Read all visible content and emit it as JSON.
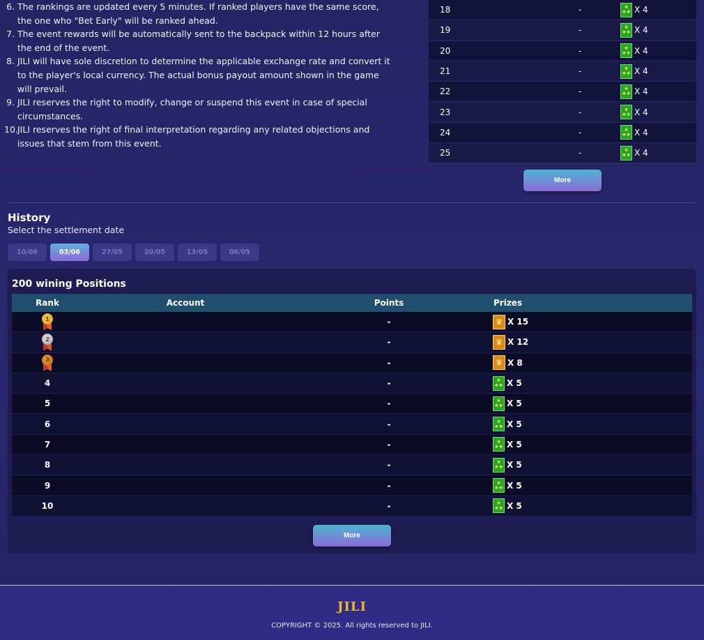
{
  "rules": [
    {
      "num": "6.",
      "text": "The rankings are updated every 5 minutes. If ranked players have the same score, the one who \"Bet Early\" will be ranked ahead."
    },
    {
      "num": "7.",
      "text": "The event rewards will be automatically sent to the backpack within 12 hours after the end of the event."
    },
    {
      "num": "8.",
      "text": "JILI will have sole discretion to determine the applicable exchange rate and convert it to the player's local currency. The actual bonus payout amount shown in the game will prevail."
    },
    {
      "num": "9.",
      "text": "JILI reserves the right to modify, change or suspend this event in case of special circumstances."
    },
    {
      "num": "10.",
      "text": "JILI reserves the right of final interpretation regarding any related objections and issues that stem from this event."
    }
  ],
  "current_ranking": {
    "rows": [
      {
        "rank": "18",
        "points": "-",
        "prize": "X 4"
      },
      {
        "rank": "19",
        "points": "-",
        "prize": "X 4"
      },
      {
        "rank": "20",
        "points": "-",
        "prize": "X 4"
      },
      {
        "rank": "21",
        "points": "-",
        "prize": "X 4"
      },
      {
        "rank": "22",
        "points": "-",
        "prize": "X 4"
      },
      {
        "rank": "23",
        "points": "-",
        "prize": "X 4"
      },
      {
        "rank": "24",
        "points": "-",
        "prize": "X 4"
      },
      {
        "rank": "25",
        "points": "-",
        "prize": "X 4"
      }
    ],
    "more_label": "More"
  },
  "history": {
    "title": "History",
    "subtitle": "Select the settlement date",
    "dates": [
      "10/06",
      "03/06",
      "27/05",
      "20/05",
      "13/05",
      "06/05"
    ],
    "active_date_index": 1,
    "panel_title": "200 wining Positions",
    "columns": {
      "rank": "Rank",
      "account": "Account",
      "points": "Points",
      "prizes": "Prizes"
    },
    "rows": [
      {
        "rank": "1",
        "medal": "gold",
        "account": "",
        "points": "-",
        "prize_icon": "crown-chest-icon",
        "prize": "X 15"
      },
      {
        "rank": "2",
        "medal": "silver",
        "account": "",
        "points": "-",
        "prize_icon": "crown-chest-icon",
        "prize": "X 12"
      },
      {
        "rank": "3",
        "medal": "bronze",
        "account": "",
        "points": "-",
        "prize_icon": "crown-chest-icon",
        "prize": "X 8"
      },
      {
        "rank": "4",
        "medal": "",
        "account": "",
        "points": "-",
        "prize_icon": "star-gift-icon",
        "prize": "X 5"
      },
      {
        "rank": "5",
        "medal": "",
        "account": "",
        "points": "-",
        "prize_icon": "star-gift-icon",
        "prize": "X 5"
      },
      {
        "rank": "6",
        "medal": "",
        "account": "",
        "points": "-",
        "prize_icon": "star-gift-icon",
        "prize": "X 5"
      },
      {
        "rank": "7",
        "medal": "",
        "account": "",
        "points": "-",
        "prize_icon": "star-gift-icon",
        "prize": "X 5"
      },
      {
        "rank": "8",
        "medal": "",
        "account": "",
        "points": "-",
        "prize_icon": "star-gift-icon",
        "prize": "X 5"
      },
      {
        "rank": "9",
        "medal": "",
        "account": "",
        "points": "-",
        "prize_icon": "star-gift-icon",
        "prize": "X 5"
      },
      {
        "rank": "10",
        "medal": "",
        "account": "",
        "points": "-",
        "prize_icon": "star-gift-icon",
        "prize": "X 5"
      }
    ],
    "more_label": "More"
  },
  "footer": {
    "logo": "JILI",
    "copyright": "COPYRIGHT © 2025. All rights reserved to JILI."
  },
  "colors": {
    "background": "#262464",
    "table_header": "#1f4e6e",
    "button_gradient_top": "#4cb5cf",
    "button_gradient_bottom": "#8c6ad8",
    "logo_gold": "#f4b820"
  }
}
